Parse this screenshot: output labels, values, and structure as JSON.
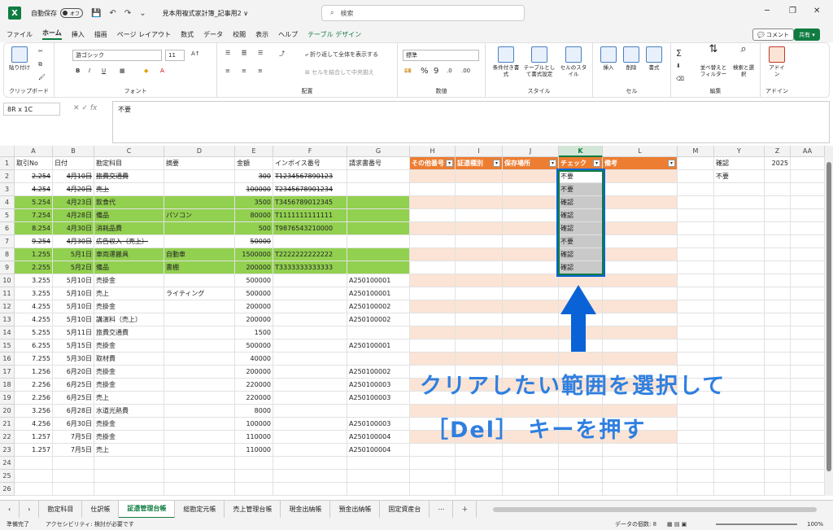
{
  "title": {
    "autosave_label": "自動保存",
    "toggle_state": "オフ",
    "doc_name": "見本用複式家計簿_記事用2 ∨",
    "search_placeholder": "検索"
  },
  "menu": [
    "ファイル",
    "ホーム",
    "挿入",
    "描画",
    "ページ レイアウト",
    "数式",
    "データ",
    "校閲",
    "表示",
    "ヘルプ",
    "テーブル デザイン"
  ],
  "comment_label": "コメント",
  "share_label": "共有",
  "ribbon": {
    "paste": "貼り付け",
    "clipboard": "クリップボード",
    "font_name": "游ゴシック",
    "font_size": "11",
    "font": "フォント",
    "wrap": "折り返して全体を表示する",
    "merge": "セルを結合して中央揃え",
    "alignment": "配置",
    "number_format": "標準",
    "number": "数値",
    "conditional": "条件付き書式",
    "table_format": "テーブルとして書式設定",
    "cell_style": "セルのスタイル",
    "style": "スタイル",
    "insert": "挿入",
    "delete": "削除",
    "format": "書式",
    "cell": "セル",
    "sort": "並べ替えとフィルター",
    "find": "検索と選択",
    "edit": "編集",
    "addin": "アドイン",
    "addin_label": "アドイン"
  },
  "formula": {
    "name_box": "8R x 1C",
    "content": "不要"
  },
  "columns": [
    "A",
    "B",
    "C",
    "D",
    "E",
    "F",
    "G",
    "H",
    "I",
    "J",
    "K",
    "L",
    "M",
    "Y",
    "Z",
    "AA"
  ],
  "headers": {
    "A": "取引No",
    "B": "日付",
    "C": "勘定科目",
    "D": "摘要",
    "E": "金額",
    "F": "インボイス番号",
    "G": "請求書番号",
    "H": "その他番号",
    "I": "証憑種別",
    "J": "保存場所",
    "K": "チェック",
    "L": "備考",
    "Y": "確認",
    "Z": "2025"
  },
  "rows": [
    {
      "n": "2",
      "a": "2.254",
      "b": "4月10日",
      "c": "旅費交通費",
      "d": "",
      "e": "300",
      "f": "T1234567890123",
      "g": "",
      "k": "不要",
      "y": "不要",
      "style": "strike"
    },
    {
      "n": "3",
      "a": "4.254",
      "b": "4月20日",
      "c": "売上",
      "d": "",
      "e": "100000",
      "f": "T2345678901234",
      "g": "",
      "k": "不要",
      "y": "",
      "style": "strike"
    },
    {
      "n": "4",
      "a": "5.254",
      "b": "4月23日",
      "c": "飲食代",
      "d": "",
      "e": "3500",
      "f": "T3456789012345",
      "g": "",
      "k": "確認",
      "y": "",
      "style": "green"
    },
    {
      "n": "5",
      "a": "7.254",
      "b": "4月28日",
      "c": "備品",
      "d": "パソコン",
      "e": "80000",
      "f": "T1111111111111",
      "g": "",
      "k": "確認",
      "y": "",
      "style": "green"
    },
    {
      "n": "6",
      "a": "8.254",
      "b": "4月30日",
      "c": "消耗品費",
      "d": "",
      "e": "500",
      "f": "T9876543210000",
      "g": "",
      "k": "確認",
      "y": "",
      "style": "green"
    },
    {
      "n": "7",
      "a": "9.254",
      "b": "4月30日",
      "c": "広告収入（売上）",
      "d": "",
      "e": "50000",
      "f": "",
      "g": "",
      "k": "不要",
      "y": "",
      "style": "strike"
    },
    {
      "n": "8",
      "a": "1.255",
      "b": "5月1日",
      "c": "車両運搬具",
      "d": "自動車",
      "e": "1500000",
      "f": "T2222222222222",
      "g": "",
      "k": "確認",
      "y": "",
      "style": "green"
    },
    {
      "n": "9",
      "a": "2.255",
      "b": "5月2日",
      "c": "備品",
      "d": "書棚",
      "e": "200000",
      "f": "T3333333333333",
      "g": "",
      "k": "確認",
      "y": "",
      "style": "green"
    },
    {
      "n": "10",
      "a": "3.255",
      "b": "5月10日",
      "c": "売掛金",
      "d": "",
      "e": "500000",
      "f": "",
      "g": "A250100001",
      "k": "",
      "y": "",
      "style": ""
    },
    {
      "n": "11",
      "a": "3.255",
      "b": "5月10日",
      "c": "売上",
      "d": "ライティング",
      "e": "500000",
      "f": "",
      "g": "A250100001",
      "k": "",
      "y": "",
      "style": ""
    },
    {
      "n": "12",
      "a": "4.255",
      "b": "5月10日",
      "c": "売掛金",
      "d": "",
      "e": "200000",
      "f": "",
      "g": "A250100002",
      "k": "",
      "y": "",
      "style": ""
    },
    {
      "n": "13",
      "a": "4.255",
      "b": "5月10日",
      "c": "講演料（売上）",
      "d": "",
      "e": "200000",
      "f": "",
      "g": "A250100002",
      "k": "",
      "y": "",
      "style": ""
    },
    {
      "n": "14",
      "a": "5.255",
      "b": "5月11日",
      "c": "旅費交通費",
      "d": "",
      "e": "1500",
      "f": "",
      "g": "",
      "k": "",
      "y": "",
      "style": ""
    },
    {
      "n": "15",
      "a": "6.255",
      "b": "5月15日",
      "c": "売掛金",
      "d": "",
      "e": "500000",
      "f": "",
      "g": "A250100001",
      "k": "",
      "y": "",
      "style": ""
    },
    {
      "n": "16",
      "a": "7.255",
      "b": "5月30日",
      "c": "取材費",
      "d": "",
      "e": "40000",
      "f": "",
      "g": "",
      "k": "",
      "y": "",
      "style": ""
    },
    {
      "n": "17",
      "a": "1.256",
      "b": "6月20日",
      "c": "売掛金",
      "d": "",
      "e": "200000",
      "f": "",
      "g": "A250100002",
      "k": "",
      "y": "",
      "style": ""
    },
    {
      "n": "18",
      "a": "2.256",
      "b": "6月25日",
      "c": "売掛金",
      "d": "",
      "e": "220000",
      "f": "",
      "g": "A250100003",
      "k": "",
      "y": "",
      "style": ""
    },
    {
      "n": "19",
      "a": "2.256",
      "b": "6月25日",
      "c": "売上",
      "d": "",
      "e": "220000",
      "f": "",
      "g": "A250100003",
      "k": "",
      "y": "",
      "style": ""
    },
    {
      "n": "20",
      "a": "3.256",
      "b": "6月28日",
      "c": "水道光熱費",
      "d": "",
      "e": "8000",
      "f": "",
      "g": "",
      "k": "",
      "y": "",
      "style": ""
    },
    {
      "n": "21",
      "a": "4.256",
      "b": "6月30日",
      "c": "売掛金",
      "d": "",
      "e": "100000",
      "f": "",
      "g": "A250100003",
      "k": "",
      "y": "",
      "style": ""
    },
    {
      "n": "22",
      "a": "1.257",
      "b": "7月5日",
      "c": "売掛金",
      "d": "",
      "e": "110000",
      "f": "",
      "g": "A250100004",
      "k": "",
      "y": "",
      "style": ""
    },
    {
      "n": "23",
      "a": "1.257",
      "b": "7月5日",
      "c": "売上",
      "d": "",
      "e": "110000",
      "f": "",
      "g": "A250100004",
      "k": "",
      "y": "",
      "style": ""
    },
    {
      "n": "24",
      "a": "",
      "b": "",
      "c": "",
      "d": "",
      "e": "",
      "f": "",
      "g": "",
      "k": "",
      "y": "",
      "style": "empty"
    },
    {
      "n": "25",
      "a": "",
      "b": "",
      "c": "",
      "d": "",
      "e": "",
      "f": "",
      "g": "",
      "k": "",
      "y": "",
      "style": "empty"
    },
    {
      "n": "26",
      "a": "",
      "b": "",
      "c": "",
      "d": "",
      "e": "",
      "f": "",
      "g": "",
      "k": "",
      "y": "",
      "style": "empty"
    }
  ],
  "callout": {
    "line1": "クリアしたい範囲を選択して",
    "line2": "［Del］ キーを押す"
  },
  "sheet_tabs": [
    "勘定科目",
    "仕訳帳",
    "証憑管理台帳",
    "総勘定元帳",
    "売上管理台帳",
    "現金出納帳",
    "預金出納帳",
    "固定資産台"
  ],
  "active_sheet": "証憑管理台帳",
  "status": {
    "ready": "準備完了",
    "accessibility": "アクセシビリティ: 検討が必要です",
    "count": "データの個数: 8",
    "zoom": "100%"
  },
  "colors": {
    "excel_green": "#107c41",
    "row_green": "#92d050",
    "table_header_orange": "#ed7d31",
    "table_band": "#fbe4d5",
    "selection_gray": "#c9c9c9",
    "callout_blue": "#2f7fe0"
  }
}
